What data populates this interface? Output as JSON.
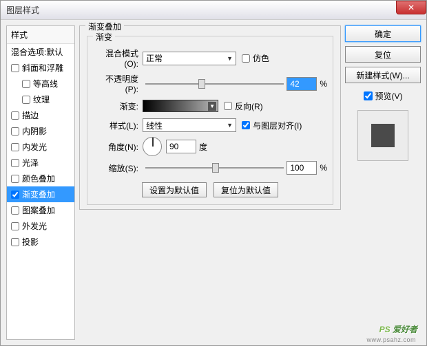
{
  "window": {
    "title": "图层样式"
  },
  "sidebar": {
    "header": "样式",
    "blend_defaults": "混合选项:默认",
    "items": [
      {
        "label": "斜面和浮雕",
        "checked": false
      },
      {
        "label": "等高线",
        "checked": false,
        "indent": true
      },
      {
        "label": "纹理",
        "checked": false,
        "indent": true
      },
      {
        "label": "描边",
        "checked": false
      },
      {
        "label": "内阴影",
        "checked": false
      },
      {
        "label": "内发光",
        "checked": false
      },
      {
        "label": "光泽",
        "checked": false
      },
      {
        "label": "颜色叠加",
        "checked": false
      },
      {
        "label": "渐变叠加",
        "checked": true,
        "selected": true
      },
      {
        "label": "图案叠加",
        "checked": false
      },
      {
        "label": "外发光",
        "checked": false
      },
      {
        "label": "投影",
        "checked": false
      }
    ]
  },
  "main": {
    "group_title": "渐变叠加",
    "inner_title": "渐变",
    "blend_mode": {
      "label": "混合模式(O):",
      "value": "正常"
    },
    "dither": {
      "label": "仿色",
      "checked": false
    },
    "opacity": {
      "label": "不透明度(P):",
      "value": "42",
      "unit": "%"
    },
    "gradient": {
      "label": "渐变:"
    },
    "reverse": {
      "label": "反向(R)",
      "checked": false
    },
    "style": {
      "label": "样式(L):",
      "value": "线性"
    },
    "align": {
      "label": "与图层对齐(I)",
      "checked": true
    },
    "angle": {
      "label": "角度(N):",
      "value": "90",
      "unit": "度"
    },
    "scale": {
      "label": "缩放(S):",
      "value": "100",
      "unit": "%"
    },
    "reset_default": "设置为默认值",
    "restore_default": "复位为默认值"
  },
  "right": {
    "ok": "确定",
    "reset": "复位",
    "new_style": "新建样式(W)...",
    "preview": {
      "label": "预览(V)",
      "checked": true
    }
  },
  "watermark": {
    "text1": "PS",
    "text2": " 爱好者",
    "sub": "www.psahz.com"
  }
}
